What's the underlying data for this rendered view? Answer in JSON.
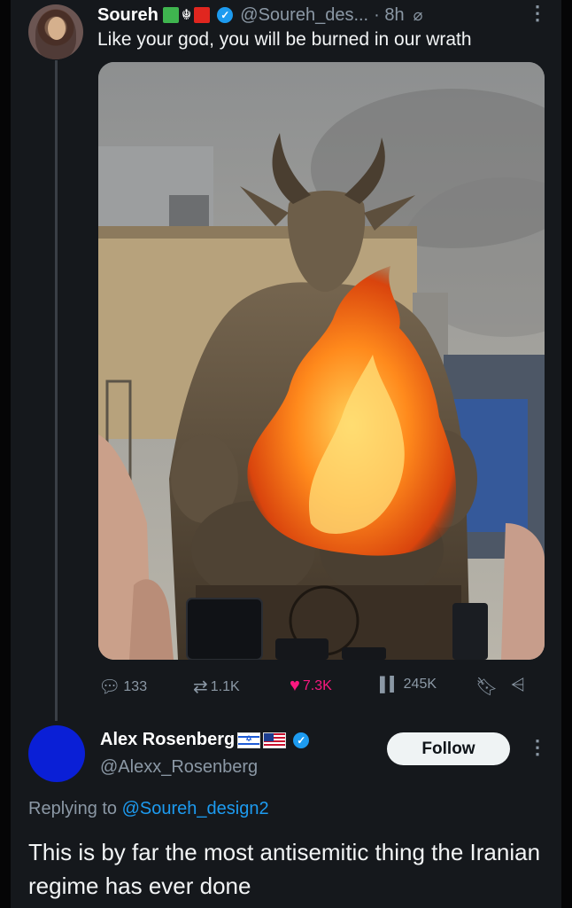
{
  "tweet1": {
    "author_name": "Soureh",
    "badge_colors": [
      "#3fb54f",
      "#e0261f"
    ],
    "verified_icon": "verified-badge-icon",
    "handle": "@Soureh_des...",
    "time": "· 8h",
    "text": "Like your god, you will be burned in our wrath",
    "image_desc": "photo",
    "stats": {
      "replies": "133",
      "reposts": "1.1K",
      "likes": "7.3K",
      "views": "245K"
    }
  },
  "tweet2": {
    "author_name": "Alex Rosenberg",
    "handle": "@Alexx_Rosenberg",
    "follow_label": "Follow",
    "replying_prefix": "Replying to",
    "replying_mention": "@Soureh_design2",
    "text": "This is by far the most antisemitic thing the Iranian regime has ever done",
    "avatar_color": "#0a1fd6"
  },
  "colors": {
    "like": "#f91880",
    "link": "#1d9bf0",
    "muted": "#8b98a5"
  }
}
